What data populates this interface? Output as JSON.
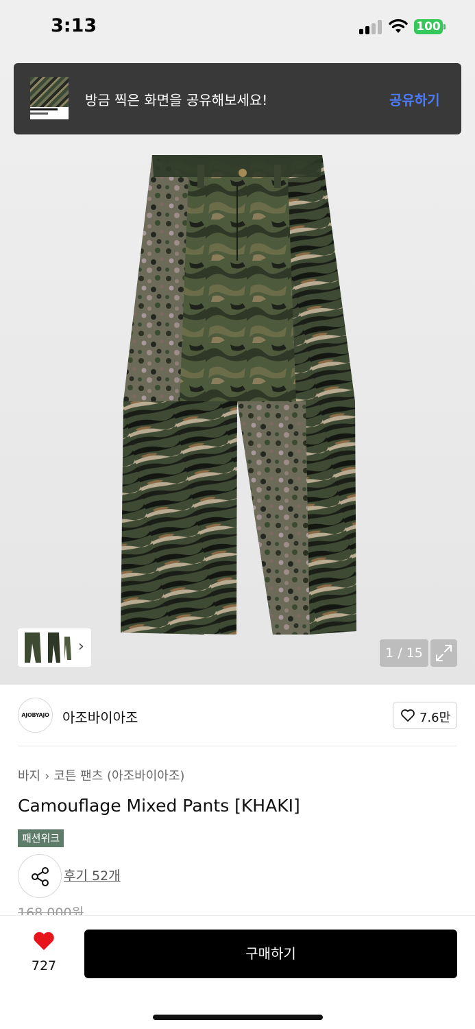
{
  "status_bar": {
    "time": "3:13",
    "battery": "100"
  },
  "toast": {
    "message": "방금 찍은 화면을 공유해보세요!",
    "action": "공유하기"
  },
  "gallery": {
    "page_indicator": "1 / 15",
    "current_page": 1,
    "total_pages": 15
  },
  "brand": {
    "logo_text": "AJOBYAJO",
    "name": "아조바이아조",
    "likes": "7.6만"
  },
  "breadcrumb": {
    "category": "바지",
    "subcategory": "코튼 팬츠 (아조바이아조)"
  },
  "product": {
    "title": "Camouflage Mixed Pants [KHAKI]",
    "badge": "패션위크",
    "reviews": "후기 52개",
    "original_price": "168,000원"
  },
  "bottom_bar": {
    "wish_count": "727",
    "buy_label": "구매하기"
  },
  "colors": {
    "accent_blue": "#4b7bff",
    "heart_red": "#e8141c",
    "badge_green": "#5f7b6a",
    "battery_green": "#34c759"
  }
}
